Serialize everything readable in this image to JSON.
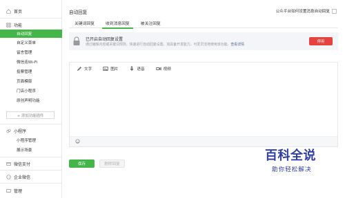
{
  "sidebar": {
    "home": "首页",
    "functions": "功能",
    "items": [
      "自动回复",
      "自定义菜单",
      "留言管理",
      "微信连Wi-Fi",
      "投票管理",
      "页面模版",
      "门店小程序",
      "原创声明功能"
    ],
    "add_plugin": "+ 添加功能插件",
    "miniprogram": "小程序",
    "mp_items": [
      "小程序管理",
      "展示场景"
    ],
    "pay": "微信支付",
    "enterprise": "企业微信",
    "manage": "管理"
  },
  "main": {
    "title": "自动回复",
    "top_right": "公众平台如何设置消息自动回复",
    "tabs": [
      "关键词回复",
      "收到消息回复",
      "被关注回复"
    ],
    "status": {
      "title": "已开启自动回复设置",
      "desc": "通过编辑内容或关键词规则，快速进行自动回复设置。如具备开发能力，可更灵活地使用该功能。",
      "link": "查看详情",
      "stop": "停用"
    },
    "toolbar": [
      "文字",
      "图片",
      "语音",
      "视频"
    ],
    "save": "保存",
    "delete": "删除回复"
  },
  "watermark": {
    "main": "百科全说",
    "sub": "助你轻松解决"
  },
  "colors": {
    "accent": "#44b549",
    "danger": "#e64340",
    "link": "#576b95",
    "watermark": "#2f3ea6"
  }
}
